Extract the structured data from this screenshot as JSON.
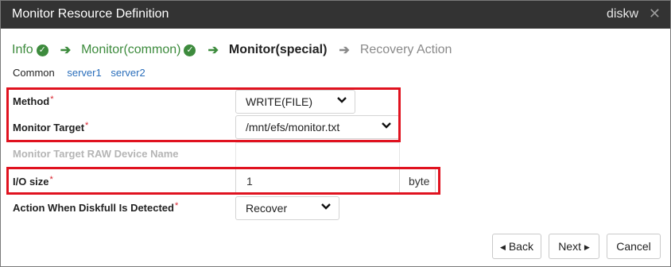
{
  "window": {
    "title": "Monitor Resource Definition",
    "subtitle": "diskw",
    "close_glyph": "✕"
  },
  "wizard": {
    "steps": [
      {
        "label": "Info",
        "state": "done"
      },
      {
        "label": "Monitor(common)",
        "state": "done"
      },
      {
        "label": "Monitor(special)",
        "state": "current"
      },
      {
        "label": "Recovery Action",
        "state": "future"
      }
    ],
    "check_glyph": "✓",
    "arrow_glyph": "➔"
  },
  "tabs": {
    "active": "Common",
    "links": [
      "server1",
      "server2"
    ]
  },
  "form": {
    "required_mark": "*",
    "method": {
      "label": "Method",
      "value": "WRITE(FILE)"
    },
    "monitor_target": {
      "label": "Monitor Target",
      "value": "/mnt/efs/monitor.txt"
    },
    "raw_device": {
      "label": "Monitor Target RAW Device Name",
      "value": ""
    },
    "io_size": {
      "label": "I/O size",
      "value": "1",
      "unit": "byte"
    },
    "diskfull_action": {
      "label": "Action When Diskfull Is Detected",
      "value": "Recover"
    }
  },
  "buttons": {
    "back": "Back",
    "next": "Next",
    "cancel": "Cancel",
    "left_glyph": "◀",
    "right_glyph": "▶"
  },
  "colors": {
    "titlebar": "#333333",
    "done": "#3d8b3d",
    "link": "#2a6ebb",
    "highlight": "#e0121f",
    "required": "#d9232d"
  }
}
